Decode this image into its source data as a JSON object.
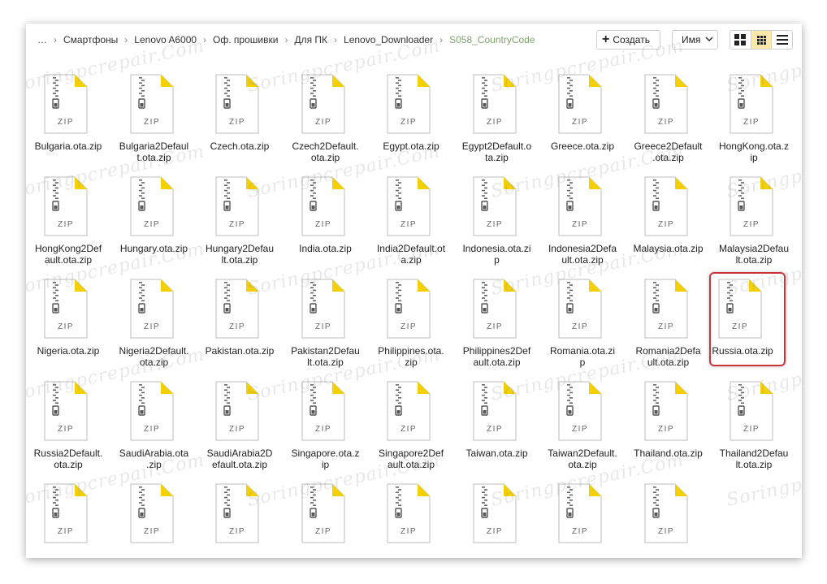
{
  "breadcrumb": {
    "ellipsis": "…",
    "items": [
      "Смартфоны",
      "Lenovo A6000",
      "Оф. прошивки",
      "Для ПК",
      "Lenovo_Downloader"
    ],
    "current": "S058_CountryCode"
  },
  "toolbar": {
    "create_label": "Создать",
    "sort_label": "Имя"
  },
  "icon_label": "ZIP",
  "watermark_text": "Soringpcrepair.Com",
  "files": [
    [
      "Bulgaria.ota.zip"
    ],
    [
      "Bulgaria2Defaul",
      "t.ota.zip"
    ],
    [
      "Czech.ota.zip"
    ],
    [
      "Czech2Default.",
      "ota.zip"
    ],
    [
      "Egypt.ota.zip"
    ],
    [
      "Egypt2Default.o",
      "ta.zip"
    ],
    [
      "Greece.ota.zip"
    ],
    [
      "Greece2Default",
      ".ota.zip"
    ],
    [
      "HongKong.ota.z",
      "ip"
    ],
    [
      "HongKong2Def",
      "ault.ota.zip"
    ],
    [
      "Hungary.ota.zip"
    ],
    [
      "Hungary2Defau",
      "lt.ota.zip"
    ],
    [
      "India.ota.zip"
    ],
    [
      "India2Default.ot",
      "a.zip"
    ],
    [
      "Indonesia.ota.zi",
      "p"
    ],
    [
      "Indonesia2Defa",
      "ult.ota.zip"
    ],
    [
      "Malaysia.ota.zip"
    ],
    [
      "Malaysia2Defau",
      "lt.ota.zip"
    ],
    [
      "Nigeria.ota.zip"
    ],
    [
      "Nigeria2Default.",
      "ota.zip"
    ],
    [
      "Pakistan.ota.zip"
    ],
    [
      "Pakistan2Defau",
      "lt.ota.zip"
    ],
    [
      "Philippines.ota.",
      "zip"
    ],
    [
      "Philippines2Def",
      "ault.ota.zip"
    ],
    [
      "Romania.ota.zi",
      "p"
    ],
    [
      "Romania2Defa",
      "ult.ota.zip"
    ],
    [
      "Russia.ota.zip"
    ],
    [
      "Russia2Default.",
      "ota.zip"
    ],
    [
      "SaudiArabia.ota",
      ".zip"
    ],
    [
      "SaudiArabia2D",
      "efault.ota.zip"
    ],
    [
      "Singapore.ota.z",
      "ip"
    ],
    [
      "Singapore2Def",
      "ault.ota.zip"
    ],
    [
      "Taiwan.ota.zip"
    ],
    [
      "Taiwan2Default.",
      "ota.zip"
    ],
    [
      "Thailand.ota.zip"
    ],
    [
      "Thailand2Defau",
      "lt.ota.zip"
    ],
    [
      ""
    ],
    [
      ""
    ],
    [
      ""
    ],
    [
      ""
    ],
    [
      ""
    ],
    [
      ""
    ],
    [
      ""
    ],
    [
      ""
    ]
  ],
  "selected_file": "Russia.ota.zip",
  "colors": {
    "fold_accent": "#f5d000",
    "selection_border": "#c9373a",
    "current_crumb": "#7fa46d",
    "active_view_bg": "#fce9a8"
  }
}
